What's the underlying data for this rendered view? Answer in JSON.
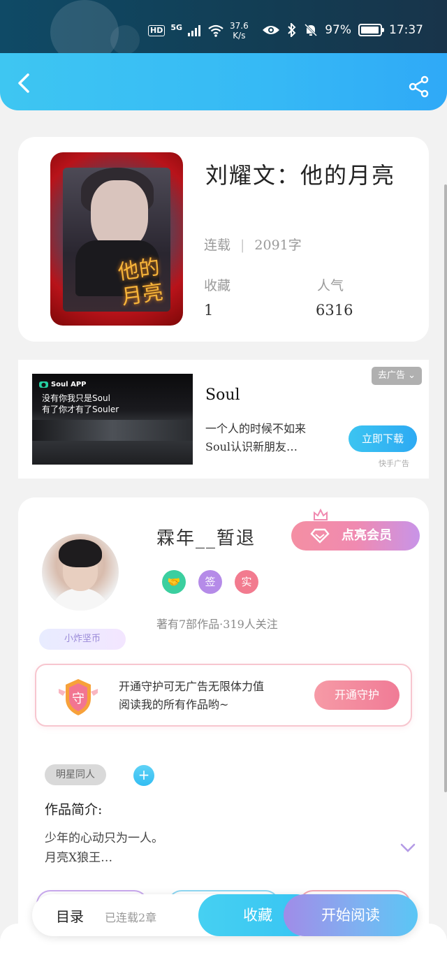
{
  "status_bar": {
    "hd": "HD",
    "network": "5G",
    "speed_value": "37.6",
    "speed_unit": "K/s",
    "battery": "97%",
    "time": "17:37"
  },
  "colors": {
    "accent_blue": "#36b9f5",
    "vip_pink": "#f08ab0",
    "guard_pink": "#f07b96"
  },
  "book": {
    "title": "刘耀文：他的月亮",
    "status": "连载",
    "word_count": "2091字",
    "favorites_label": "收藏",
    "favorites_value": "1",
    "popularity_label": "人气",
    "popularity_value": "6316",
    "cover_text": "他的月亮"
  },
  "ad": {
    "close_label": "去广告",
    "app_brand": "Soul APP",
    "image_line1": "没有你我只是Soul",
    "image_line2": "有了你才有了Souler",
    "title": "Soul",
    "description": "一个人的时候不如来Soul认识新朋友…",
    "download_label": "立即下载",
    "source": "快手广告"
  },
  "author": {
    "name": "霖年__暂退",
    "vip_label": "点亮会员",
    "tags": [
      "签",
      "实"
    ],
    "stats": "著有7部作品·319人关注",
    "badge": "小炸坚币",
    "guard_text_line1": "开通守护可无广告无限体力值",
    "guard_text_line2": "阅读我的所有作品哟~",
    "guard_button": "开通守护",
    "guard_icon_text": "守"
  },
  "intro": {
    "genre_tag": "明星同人",
    "label": "作品简介:",
    "line1": "少年的心动只为一人。",
    "line2": "月亮X狼王…"
  },
  "bottom": {
    "toc_label": "目录",
    "chapter_count": "已连载2章",
    "favorite_label": "收藏",
    "read_label": "开始阅读"
  }
}
